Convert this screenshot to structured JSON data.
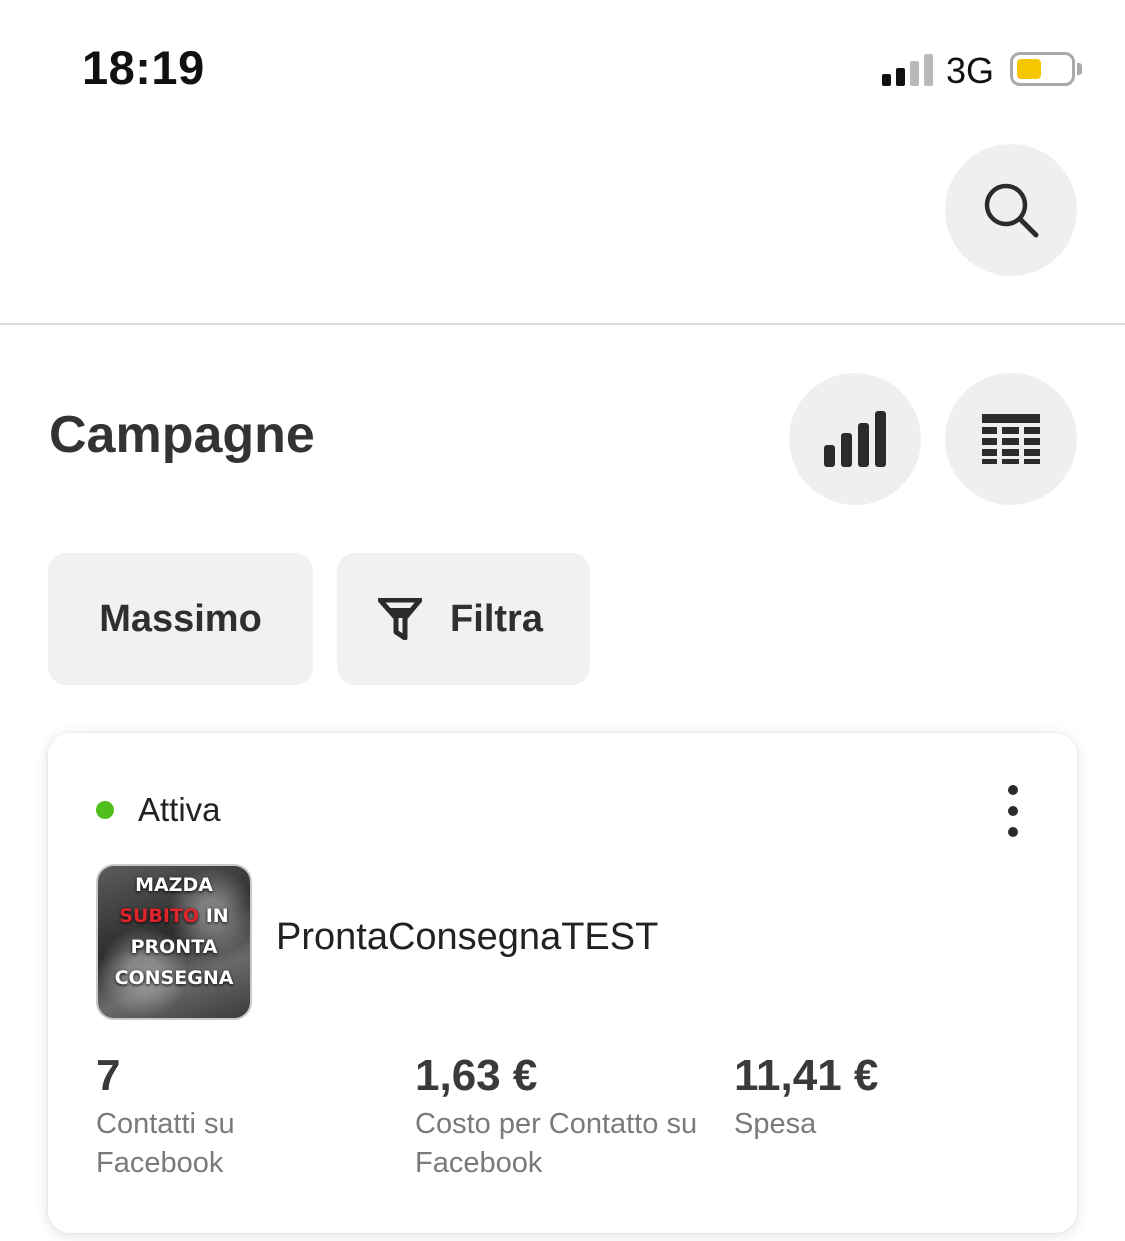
{
  "status_bar": {
    "time": "18:19",
    "network": "3G",
    "signal_bars_active": 2,
    "signal_bars_total": 4,
    "battery_level": 0.45,
    "battery_color": "#f6c700"
  },
  "header": {
    "search_icon": "search-icon"
  },
  "page": {
    "title": "Campagne",
    "chart_icon": "bar-chart-icon",
    "table_icon": "table-icon"
  },
  "filters": {
    "user_label": "Massimo",
    "filter_label": "Filtra",
    "filter_icon": "funnel-icon"
  },
  "campaign": {
    "status": "Attiva",
    "status_color": "#4fbf1b",
    "thumbnail_text": [
      "MAZDA",
      "SUBITO",
      "IN",
      "PRONTA",
      "CONSEGNA"
    ],
    "name": "ProntaConsegnaTEST",
    "metrics": [
      {
        "value": "7",
        "label": "Contatti su Facebook"
      },
      {
        "value": "1,63 €",
        "label": "Costo per Contatto su Facebook"
      },
      {
        "value": "11,41 €",
        "label": "Spesa"
      }
    ]
  }
}
